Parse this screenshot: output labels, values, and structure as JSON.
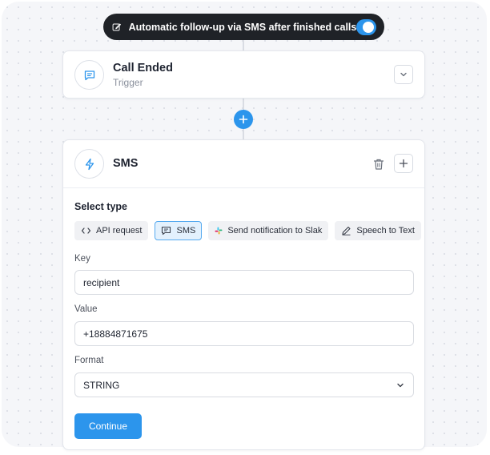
{
  "banner": {
    "label": "Automatic follow-up via SMS after finished calls",
    "toggle_on": true
  },
  "trigger_card": {
    "title": "Call Ended",
    "subtitle": "Trigger"
  },
  "sms_card": {
    "title": "SMS",
    "select_type_label": "Select type",
    "types": [
      {
        "label": "API request",
        "icon": "code-icon",
        "active": false
      },
      {
        "label": "SMS",
        "icon": "message-icon",
        "active": true
      },
      {
        "label": "Send notification to Slak",
        "icon": "slack-icon",
        "active": false
      },
      {
        "label": "Speech to Text",
        "icon": "pen-icon",
        "active": false
      }
    ],
    "key_label": "Key",
    "key_value": "recipient",
    "value_label": "Value",
    "value_value": "+18884871675",
    "format_label": "Format",
    "format_value": "STRING",
    "continue_label": "Continue"
  },
  "colors": {
    "accent": "#2c95ec",
    "banner_bg": "#1f2227",
    "canvas_bg": "#f5f6f9"
  }
}
